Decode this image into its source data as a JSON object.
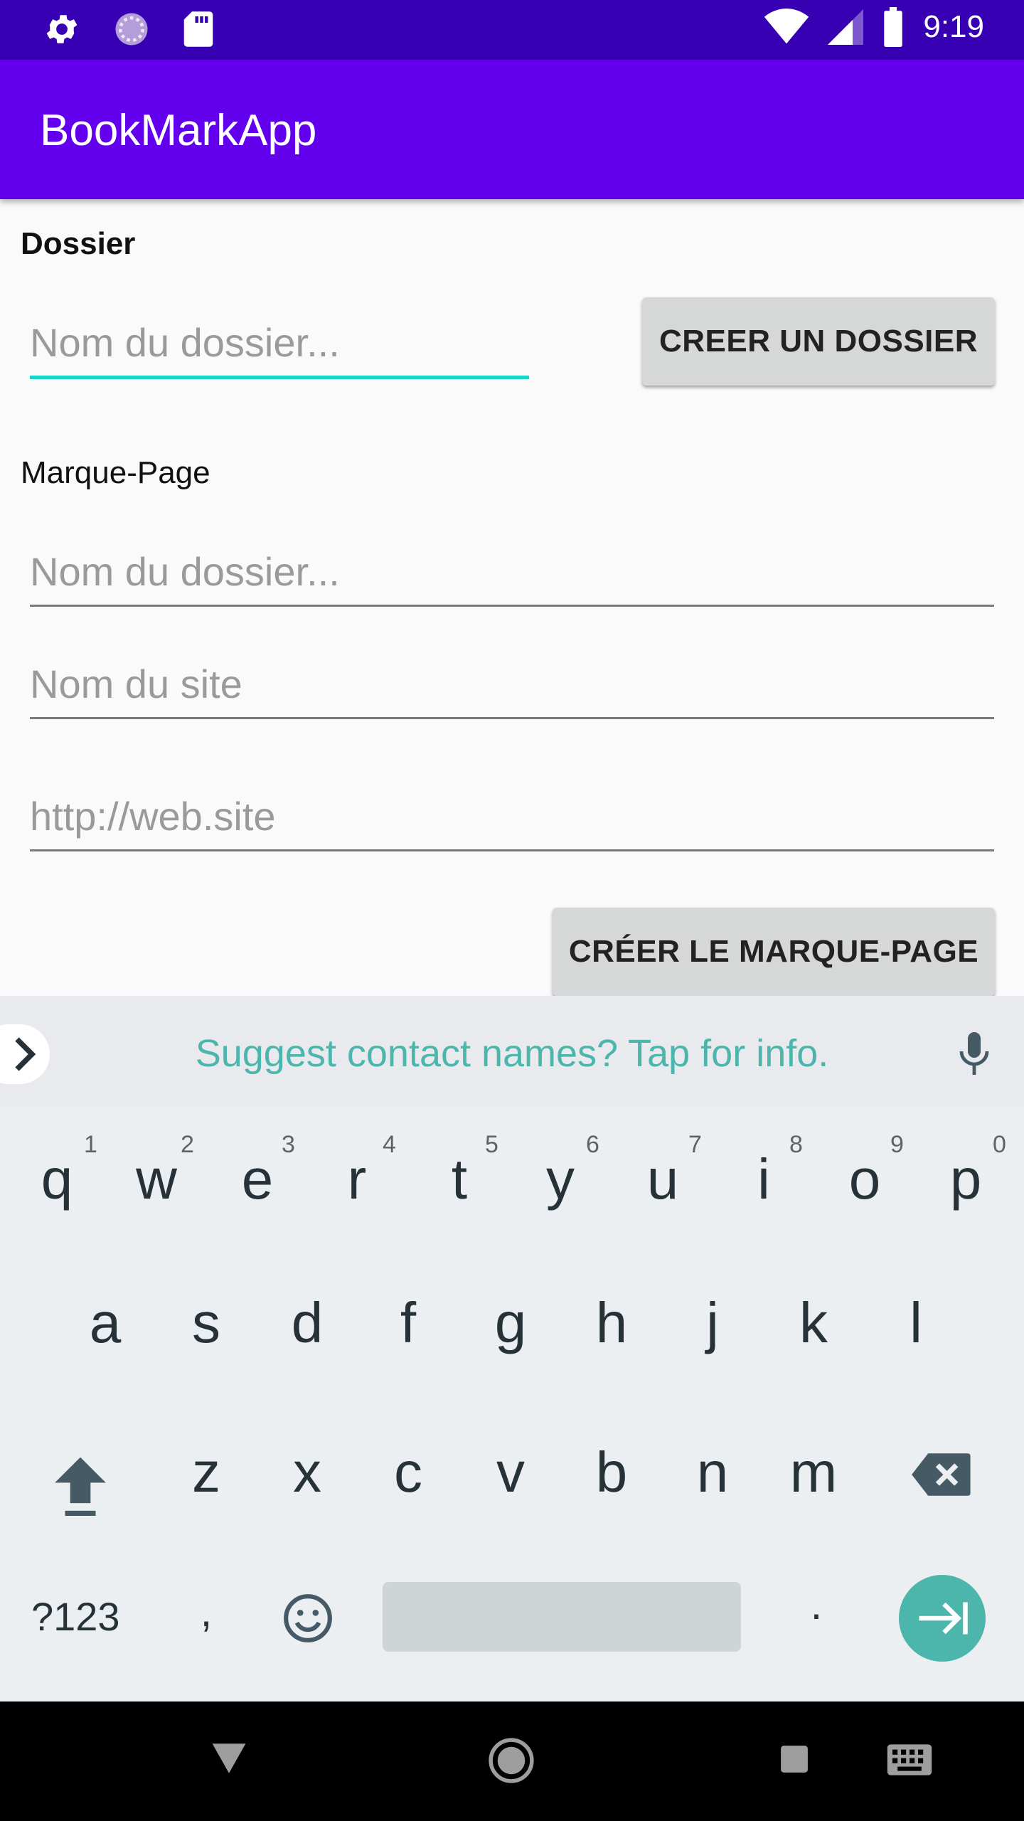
{
  "status_bar": {
    "time": "9:19",
    "icons_left": [
      "gear-icon",
      "loading-icon",
      "sd-card-icon"
    ],
    "icons_right": [
      "wifi-icon",
      "signal-icon",
      "battery-icon"
    ]
  },
  "app_bar": {
    "title": "BookMarkApp"
  },
  "dossier_section": {
    "label": "Dossier",
    "folder_input_placeholder": "Nom du dossier...",
    "create_button": "CREER UN DOSSIER"
  },
  "bookmark_section": {
    "label": "Marque-Page",
    "folder_input_placeholder": "Nom du dossier...",
    "site_name_placeholder": "Nom du site",
    "url_placeholder": "http://web.site",
    "create_button": "CRÉER LE MARQUE-PAGE"
  },
  "keyboard": {
    "suggestion": "Suggest contact names? Tap for info.",
    "row1": [
      "q",
      "w",
      "e",
      "r",
      "t",
      "y",
      "u",
      "i",
      "o",
      "p"
    ],
    "row1_hints": [
      "1",
      "2",
      "3",
      "4",
      "5",
      "6",
      "7",
      "8",
      "9",
      "0"
    ],
    "row2": [
      "a",
      "s",
      "d",
      "f",
      "g",
      "h",
      "j",
      "k",
      "l"
    ],
    "row3": [
      "z",
      "x",
      "c",
      "v",
      "b",
      "n",
      "m"
    ],
    "symbols_label": "?123",
    "comma": ",",
    "period": "."
  },
  "colors": {
    "status_bar": "#3700b3",
    "app_bar": "#6200ee",
    "accent": "#18d6c6",
    "keyboard_accent": "#4db6ac"
  }
}
